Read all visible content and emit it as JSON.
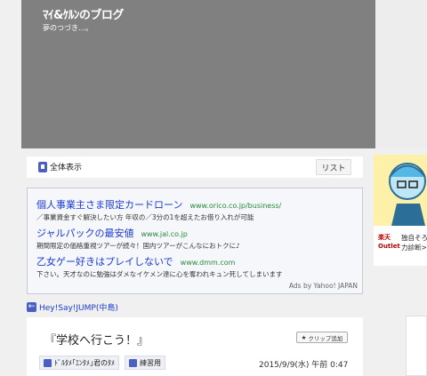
{
  "header": {
    "blog_title": "ﾏｲ&ｹﾙﾝのブログ",
    "subtitle": "夢のつづき…。"
  },
  "toolbar": {
    "all_view": "全体表示",
    "list_button": "リスト"
  },
  "ads": [
    {
      "title": "個人事業主さま限定カードローン",
      "url": "www.orico.co.jp/business/",
      "desc": "／事業資金すぐ解決したい方 年収の／3分の1を超えたお借り入れが可能"
    },
    {
      "title": "ジャルパックの最安値",
      "url": "www.jal.co.jp",
      "desc": "期間限定の価格重視ツアーが続々！国内ツアーがこんなにおトクに♪"
    },
    {
      "title": "乙女ゲー好きはプレイしないで",
      "url": "www.dmm.com",
      "desc": "下さい。天才なのに勉強はダメなイケメン達に心を奪われキュン死してしまいます"
    }
  ],
  "ad_credit": "Ads by Yahoo! JAPAN",
  "back_link": "Hey!Say!JUMP(中島)",
  "post": {
    "title": "『学校へ行こう！』",
    "clip_button": "クリップ追加",
    "tags": [
      "ﾄﾞﾙﾀﾒ｢ｴﾝﾀﾒ｣君のﾀﾒ",
      "練習用"
    ],
    "date": "2015/9/9(水) 午前 0:47"
  },
  "side": {
    "rakuten_label": "楽天 Outlet",
    "text": "独自そろ... 力診断>"
  }
}
